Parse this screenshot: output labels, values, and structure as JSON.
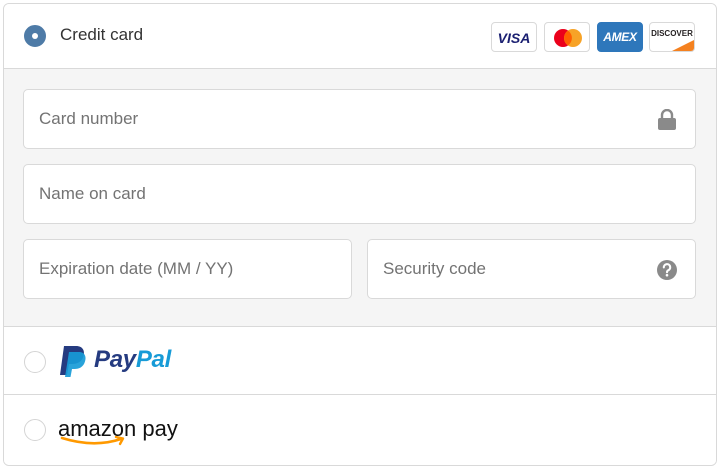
{
  "credit_card": {
    "label": "Credit card",
    "selected": true,
    "brands": [
      "VISA",
      "Mastercard",
      "AMEX",
      "DISCOVER"
    ],
    "brand_colors": {
      "visa": "#1a1f71",
      "mastercard_red": "#eb001b",
      "mastercard_orange": "#f79e1b",
      "amex": "#2e77bb",
      "discover_orange": "#f48120"
    }
  },
  "form": {
    "card_number_placeholder": "Card number",
    "name_placeholder": "Name on card",
    "expiry_placeholder": "Expiration date (MM / YY)",
    "security_code_placeholder": "Security code",
    "card_number_icon": "lock-icon",
    "security_code_icon": "help-icon"
  },
  "paypal": {
    "label_part1": "Pay",
    "label_part2": "Pal",
    "selected": false
  },
  "amazon_pay": {
    "label": "amazon pay",
    "selected": false
  },
  "colors": {
    "radio_selected": "#4e7ba7",
    "border": "#d9d9d9",
    "panel_bg": "#f5f5f5"
  }
}
